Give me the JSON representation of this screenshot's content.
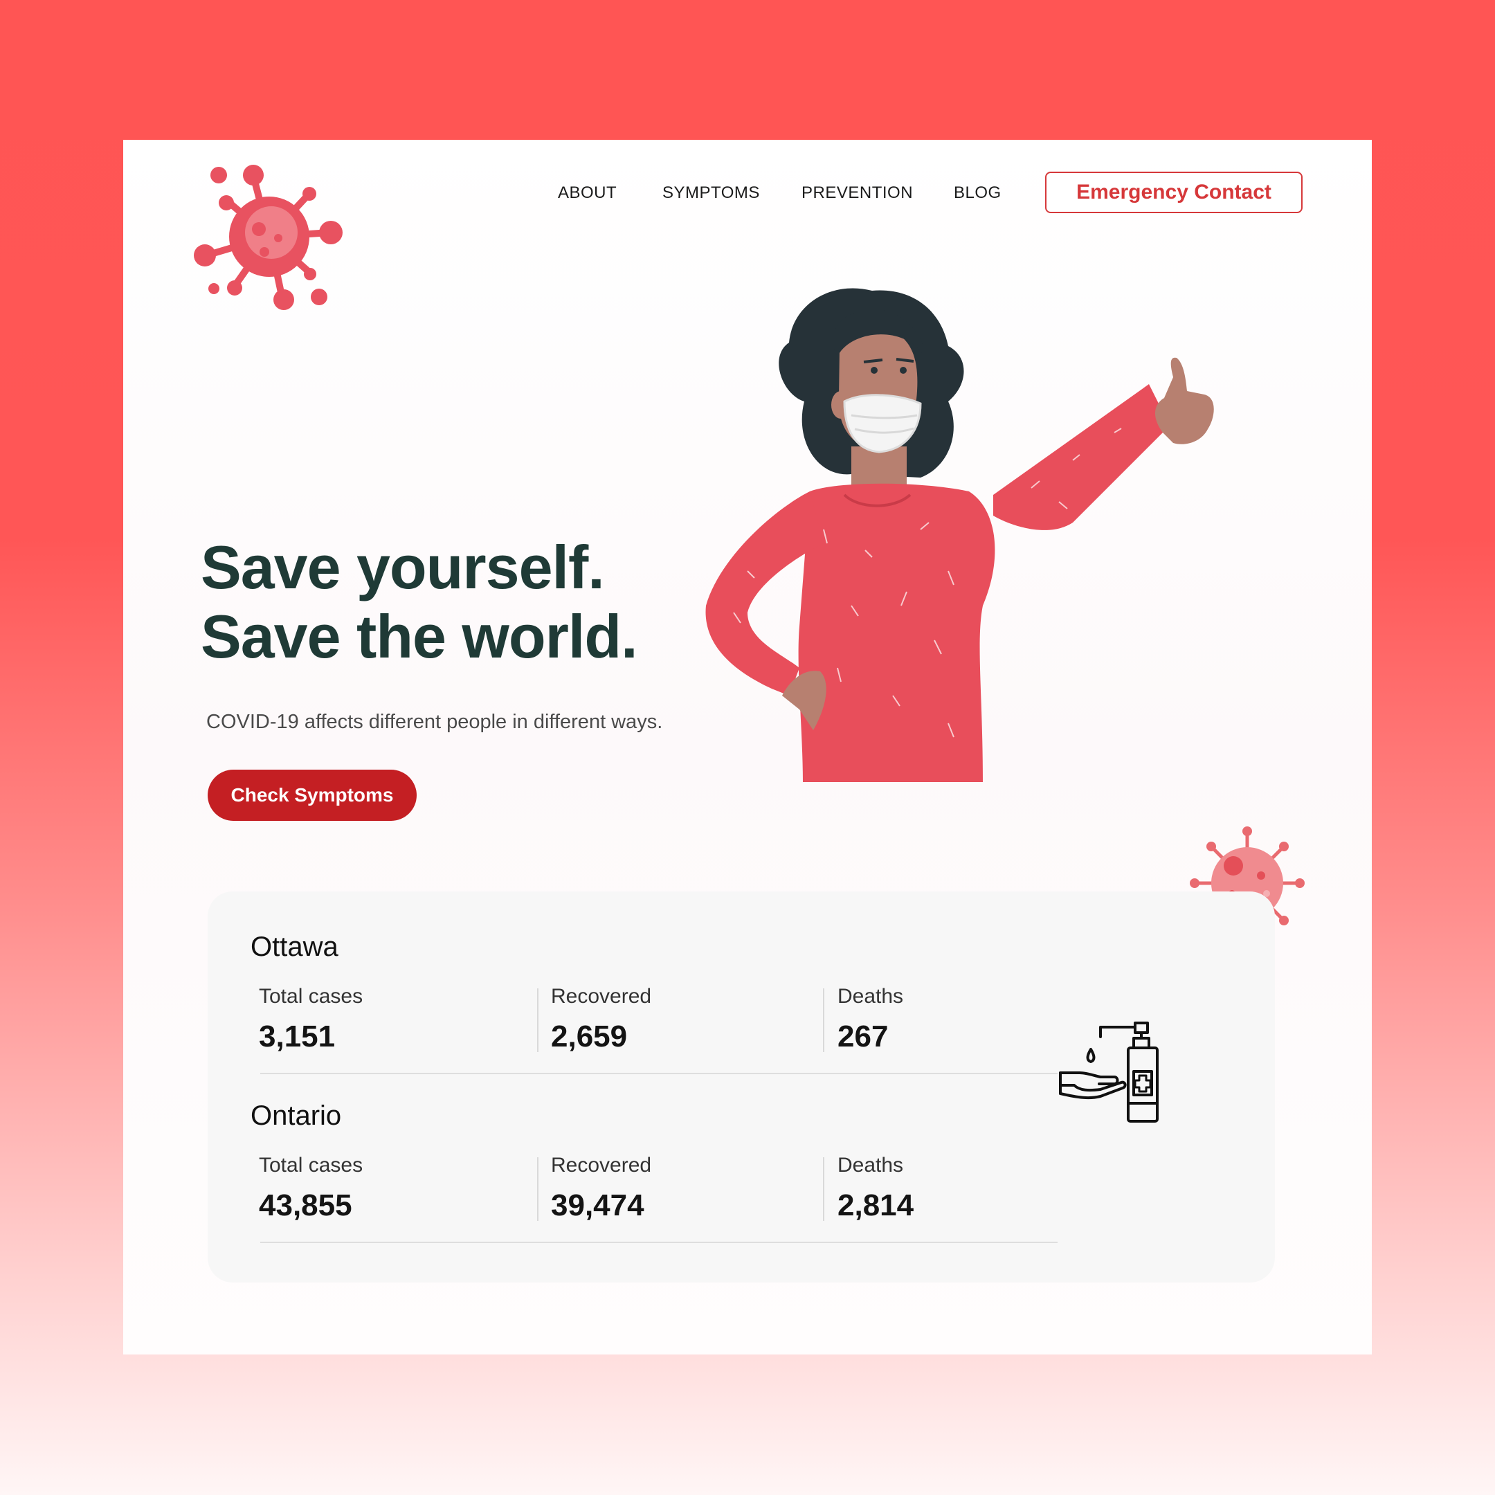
{
  "nav": {
    "about": "ABOUT",
    "symptoms": "SYMPTOMS",
    "prevention": "PREVENTION",
    "blog": "BLOG",
    "emergency": "Emergency Contact"
  },
  "hero": {
    "title_line1": "Save yourself.",
    "title_line2": "Save the world.",
    "subtitle": "COVID-19 affects different people in different ways.",
    "cta": "Check Symptoms"
  },
  "stats": {
    "regions": [
      {
        "name": "Ottawa",
        "total_label": "Total cases",
        "total": "3,151",
        "recovered_label": "Recovered",
        "recovered": "2,659",
        "deaths_label": "Deaths",
        "deaths": "267"
      },
      {
        "name": "Ontario",
        "total_label": "Total cases",
        "total": "43,855",
        "recovered_label": "Recovered",
        "recovered": "39,474",
        "deaths_label": "Deaths",
        "deaths": "2,814"
      }
    ]
  },
  "icons": {
    "logo": "virus-icon",
    "decor": "virus-icon",
    "sanitizer": "hand-sanitizer-icon"
  },
  "colors": {
    "background": "#ff5656",
    "accent": "#d6383a",
    "cta": "#c41f23",
    "heading": "#1f3a36"
  }
}
